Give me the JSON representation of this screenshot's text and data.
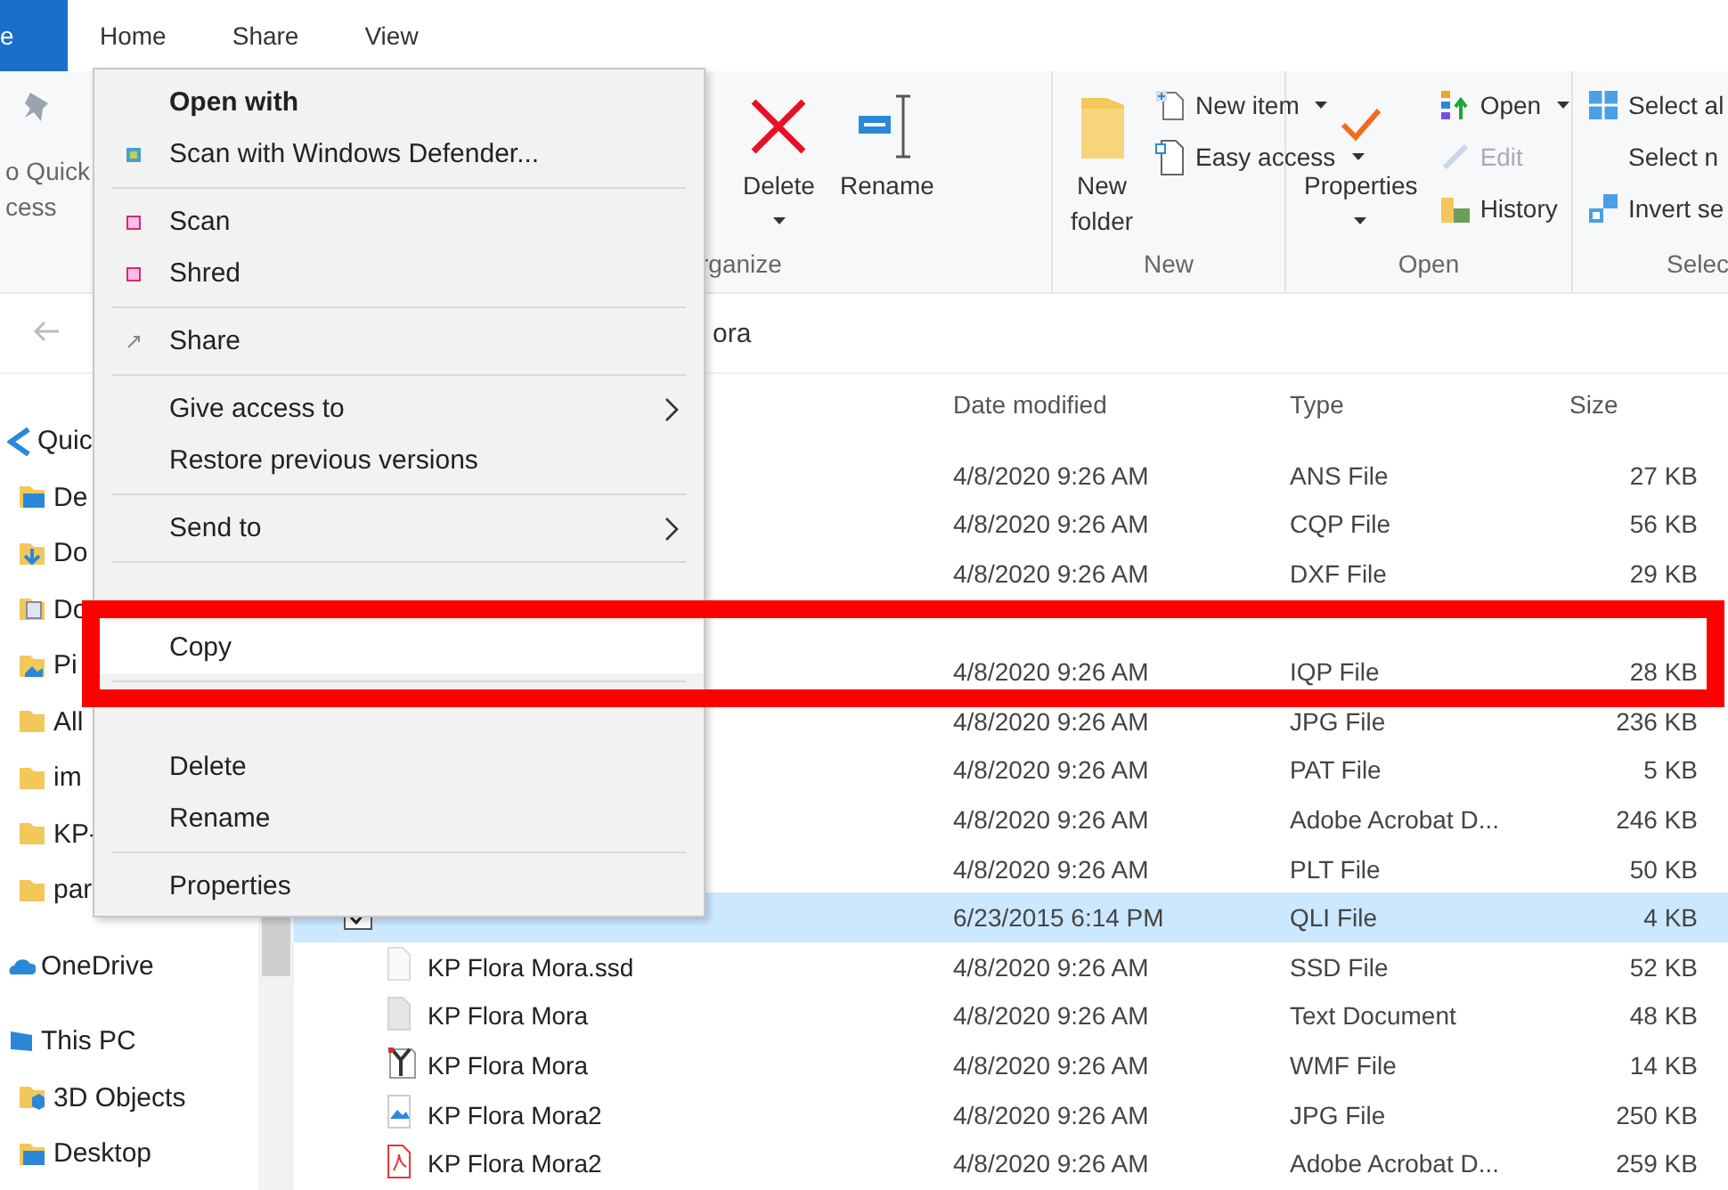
{
  "tabs": [
    {
      "label": "e",
      "kind": "file"
    },
    {
      "label": "Home",
      "kind": "tab"
    },
    {
      "label": "Share",
      "kind": "tab"
    },
    {
      "label": "View",
      "kind": "tab"
    }
  ],
  "ribbon": {
    "pin_command": {
      "lines": [
        "o Quick",
        "cess"
      ]
    },
    "groups": [
      {
        "label": "rganize",
        "commands": [
          {
            "kind": "large",
            "lines": [
              "Delete"
            ],
            "dropdown": true,
            "disabled": false
          },
          {
            "kind": "large",
            "lines": [
              "Rename"
            ],
            "dropdown": false,
            "disabled": false
          }
        ]
      },
      {
        "label": "New",
        "commands": [
          {
            "kind": "large",
            "lines": [
              "New",
              "folder"
            ],
            "dropdown": false,
            "disabled": false
          },
          {
            "kind": "small",
            "lines": [
              "New item"
            ],
            "dropdown": true,
            "disabled": false
          },
          {
            "kind": "small",
            "lines": [
              "Easy access"
            ],
            "dropdown": true,
            "disabled": false
          }
        ]
      },
      {
        "label": "Open",
        "commands": [
          {
            "kind": "large",
            "lines": [
              "Properties"
            ],
            "dropdown": true,
            "disabled": false
          },
          {
            "kind": "small",
            "lines": [
              "Open"
            ],
            "dropdown": true,
            "disabled": false
          },
          {
            "kind": "small",
            "lines": [
              "Edit"
            ],
            "dropdown": false,
            "disabled": true
          },
          {
            "kind": "small",
            "lines": [
              "History"
            ],
            "dropdown": false,
            "disabled": false
          }
        ]
      },
      {
        "label": "Selec",
        "commands": [
          {
            "kind": "small",
            "lines": [
              "Select al"
            ],
            "disabled": false
          },
          {
            "kind": "small",
            "lines": [
              "Select n"
            ],
            "disabled": false
          },
          {
            "kind": "small",
            "lines": [
              "Invert se"
            ],
            "disabled": false
          }
        ]
      }
    ]
  },
  "address": {
    "path": "ora"
  },
  "nav": {
    "items": [
      {
        "label": "Quic",
        "kind": "quick",
        "children": [
          {
            "label": "De",
            "kind": "desktop"
          },
          {
            "label": "Do",
            "kind": "downloads"
          },
          {
            "label": "Do",
            "kind": "documents"
          },
          {
            "label": "Pi",
            "kind": "pictures"
          },
          {
            "label": "All",
            "kind": "folder"
          },
          {
            "label": "im",
            "kind": "folder"
          },
          {
            "label": "KP-",
            "kind": "folder"
          },
          {
            "label": "par",
            "kind": "folder"
          }
        ]
      },
      {
        "label": "OneDrive",
        "kind": "cloud"
      },
      {
        "label": "This PC",
        "kind": "pc",
        "children": [
          {
            "label": "3D Objects",
            "kind": "objects"
          },
          {
            "label": "Desktop",
            "kind": "desktop"
          }
        ]
      }
    ]
  },
  "table": {
    "columns": [
      {
        "label": "Date modified"
      },
      {
        "label": "Type"
      },
      {
        "label": "Size"
      }
    ],
    "rows": [
      {
        "date": "4/8/2020 9:26 AM",
        "type": "ANS File",
        "size": "27 KB",
        "selected": false
      },
      {
        "date": "4/8/2020 9:26 AM",
        "type": "CQP File",
        "size": "56 KB",
        "selected": false
      },
      {
        "date": "4/8/2020 9:26 AM",
        "type": "DXF File",
        "size": "29 KB",
        "selected": false
      },
      {
        "selected": false
      },
      {
        "date": "4/8/2020 9:26 AM",
        "type": "IQP File",
        "size": "28 KB",
        "selected": false
      },
      {
        "date": "4/8/2020 9:26 AM",
        "type": "JPG File",
        "size": "236 KB",
        "selected": false
      },
      {
        "date": "4/8/2020 9:26 AM",
        "type": "PAT File",
        "size": "5 KB",
        "selected": false
      },
      {
        "date": "4/8/2020 9:26 AM",
        "type": "Adobe Acrobat D...",
        "size": "246 KB",
        "selected": false
      },
      {
        "date": "4/8/2020 9:26 AM",
        "type": "PLT File",
        "size": "50 KB",
        "selected": false
      },
      {
        "date": "6/23/2015 6:14 PM",
        "type": "QLI File",
        "size": "4 KB",
        "selected": true,
        "checked": true
      },
      {
        "name": "KP Flora Mora.ssd",
        "kind": "page",
        "date": "4/8/2020 9:26 AM",
        "type": "SSD File",
        "size": "52 KB",
        "selected": false
      },
      {
        "name": "KP Flora Mora",
        "kind": "text",
        "date": "4/8/2020 9:26 AM",
        "type": "Text Document",
        "size": "48 KB",
        "selected": false
      },
      {
        "name": "KP Flora Mora",
        "kind": "vector",
        "date": "4/8/2020 9:26 AM",
        "type": "WMF File",
        "size": "14 KB",
        "selected": false
      },
      {
        "name": "KP Flora Mora2",
        "kind": "image",
        "date": "4/8/2020 9:26 AM",
        "type": "JPG File",
        "size": "250 KB",
        "selected": false
      },
      {
        "name": "KP Flora Mora2",
        "kind": "pdf",
        "date": "4/8/2020 9:26 AM",
        "type": "Adobe Acrobat D...",
        "size": "259 KB",
        "selected": false
      }
    ]
  },
  "context_menu": {
    "sections": [
      [
        {
          "label": "Open with",
          "kind": "plain",
          "default": true,
          "submenu": false,
          "selected": false
        },
        {
          "label": "Scan with Windows Defender...",
          "kind": "defender",
          "default": false,
          "submenu": false,
          "selected": false
        }
      ],
      [
        {
          "label": "Scan",
          "kind": "scan",
          "default": false,
          "submenu": false,
          "selected": false
        },
        {
          "label": "Shred",
          "kind": "scan",
          "default": false,
          "submenu": false,
          "selected": false
        }
      ],
      [
        {
          "label": "Share",
          "kind": "share",
          "default": false,
          "submenu": false,
          "selected": false
        }
      ],
      [
        {
          "label": "Give access to",
          "kind": "plain",
          "default": false,
          "submenu": true,
          "selected": false
        },
        {
          "label": "Restore previous versions",
          "kind": "plain",
          "default": false,
          "submenu": false,
          "selected": false
        }
      ],
      [
        {
          "label": "Send to",
          "kind": "plain",
          "default": false,
          "submenu": true,
          "selected": false
        }
      ],
      [
        {
          "kind": "plain",
          "selected": false
        },
        {
          "label": "Copy",
          "kind": "plain",
          "default": false,
          "submenu": false,
          "selected": true
        }
      ],
      [
        {
          "kind": "plain",
          "selected": false
        },
        {
          "label": "Delete",
          "kind": "plain",
          "default": false,
          "submenu": false,
          "selected": false
        },
        {
          "label": "Rename",
          "kind": "plain",
          "default": false,
          "submenu": false,
          "selected": false
        }
      ],
      [
        {
          "label": "Properties",
          "kind": "plain",
          "default": false,
          "submenu": false,
          "selected": false
        }
      ]
    ]
  }
}
